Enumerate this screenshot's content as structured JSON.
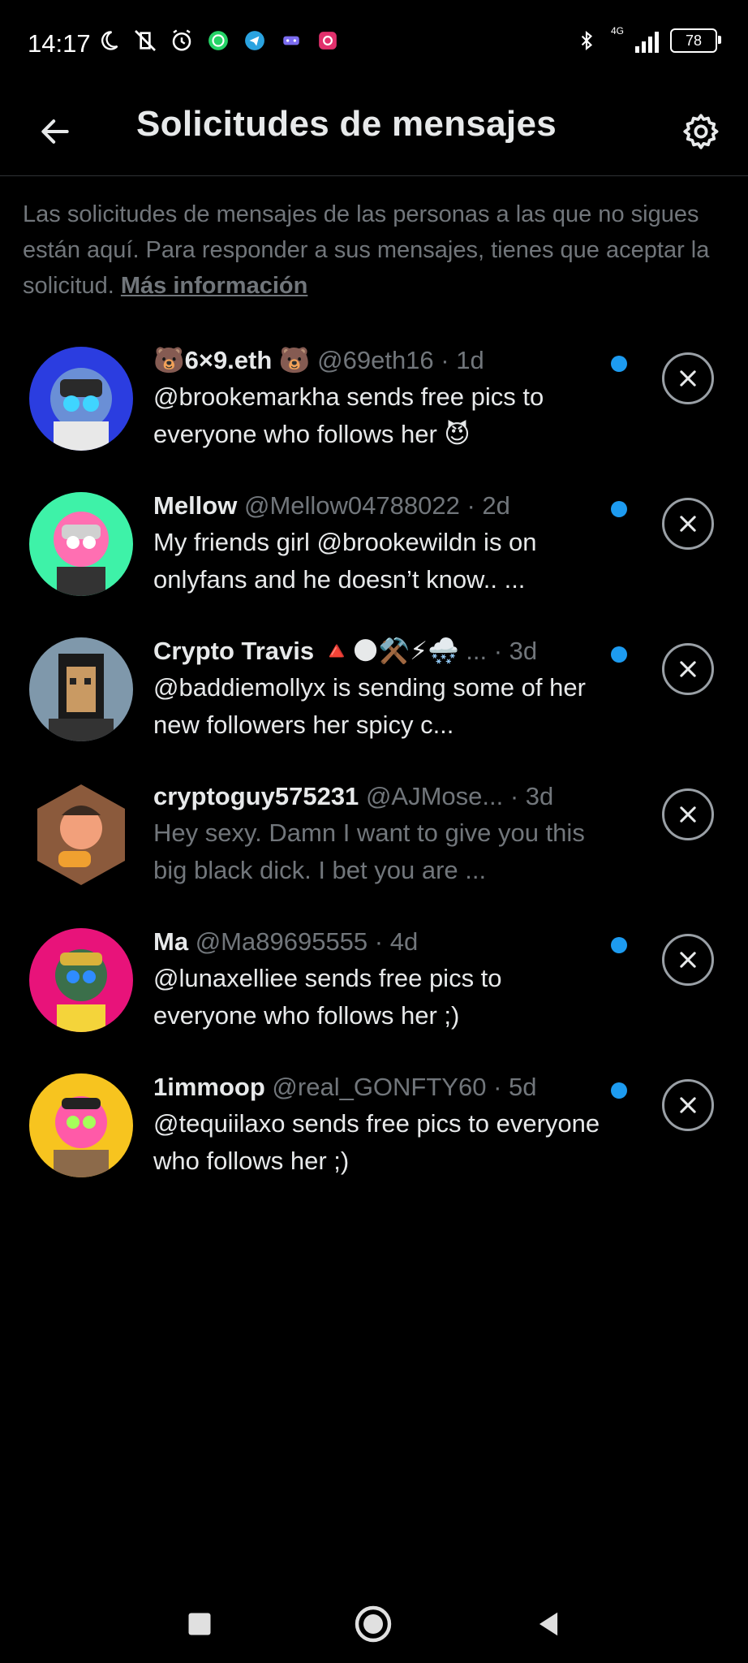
{
  "status_bar": {
    "time": "14:17",
    "network": "4G",
    "battery": "78"
  },
  "header": {
    "title": "Solicitudes de mensajes"
  },
  "intro": {
    "text": "Las solicitudes de mensajes de las personas a las que no sigues están aquí. Para responder a sus mensajes, tienes que aceptar la solicitud. ",
    "link": "Más información"
  },
  "requests": [
    {
      "name": "🐻6×9.eth 🐻",
      "handle": "@69eth16",
      "time": "· 1d",
      "message": "@brookemarkha sends free pics to everyone who follows her 😈",
      "unread": true
    },
    {
      "name": "Mellow",
      "handle": "@Mellow04788022",
      "time": "· 2d",
      "message": "My friends girl @brookewildn is on onlyfans and he doesn’t know.. ...",
      "unread": true
    },
    {
      "name": "Crypto Travis 🔺🌑⚒️⚡🌨️",
      "handle": "...",
      "time": "· 3d",
      "message": "@baddiemollyx is sending some of her new followers her spicy c...",
      "unread": true
    },
    {
      "name": "cryptoguy575231",
      "handle": "@AJMose...",
      "time": "· 3d",
      "message": "Hey sexy. Damn I want to give you this big black dick. I bet you are ...",
      "unread": false
    },
    {
      "name": "Ma",
      "handle": "@Ma89695555",
      "time": "· 4d",
      "message": "@lunaxelliee sends free pics to everyone who follows her ;)",
      "unread": true
    },
    {
      "name": "1immoop",
      "handle": "@real_GONFTY60",
      "time": "· 5d",
      "message": "@tequiilaxo sends free pics to everyone who follows her ;)",
      "unread": true
    }
  ],
  "colors": {
    "background": "#000000",
    "accent": "#1d9bf0",
    "secondary_text": "#71767b"
  }
}
